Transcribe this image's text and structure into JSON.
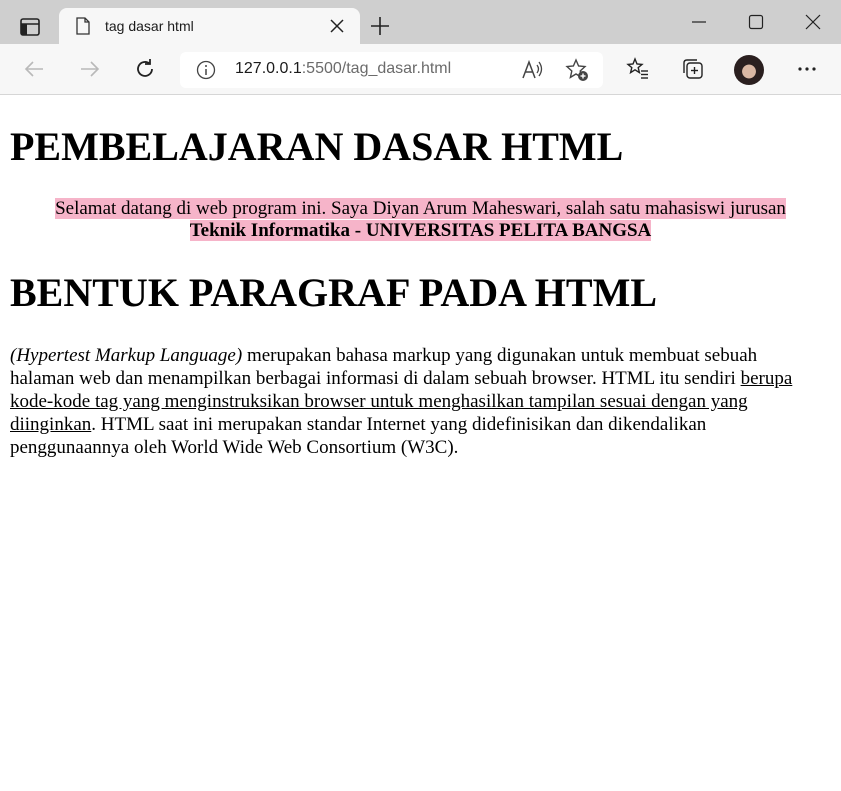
{
  "browser": {
    "tab_title": "tag dasar html",
    "url_host": "127.0.0.1",
    "url_rest": ":5500/tag_dasar.html"
  },
  "page": {
    "heading1": "PEMBELAJARAN DASAR HTML",
    "welcome_line1": "Selamat datang di web program ini. Saya Diyan Arum Maheswari, salah satu mahasiswi jurusan",
    "welcome_line2_bold": "Teknik Informatika - UNIVERSITAS PELITA BANGSA",
    "heading2": "BENTUK PARAGRAF PADA HTML",
    "para_italic": "(Hypertest Markup Language)",
    "para_text1": " merupakan bahasa markup yang digunakan untuk membuat sebuah halaman web dan menampilkan berbagai informasi di dalam sebuah browser. HTML itu sendiri ",
    "para_underlined": "berupa kode-kode tag yang menginstruksikan browser untuk menghasilkan tampilan sesuai dengan yang diinginkan",
    "para_text2": ". HTML saat ini merupakan standar Internet yang didefinisikan dan dikendalikan penggunaannya oleh World Wide Web Consortium (W3C)."
  },
  "icons": {
    "sidebar": "sidebar-icon",
    "tab": "document-icon",
    "close": "close-icon",
    "new_tab": "plus-icon",
    "back": "arrow-left-icon",
    "forward": "arrow-right-icon",
    "refresh": "refresh-icon",
    "info": "info-icon",
    "read_aloud": "read-aloud-icon",
    "add_favorite": "star-add-icon",
    "favorites": "favorites-icon",
    "collections": "collections-icon",
    "more": "more-icon"
  },
  "colors": {
    "highlight": "#f6b4c9",
    "titlebar": "#cfcfcf",
    "toolbar": "#f7f7f7"
  }
}
